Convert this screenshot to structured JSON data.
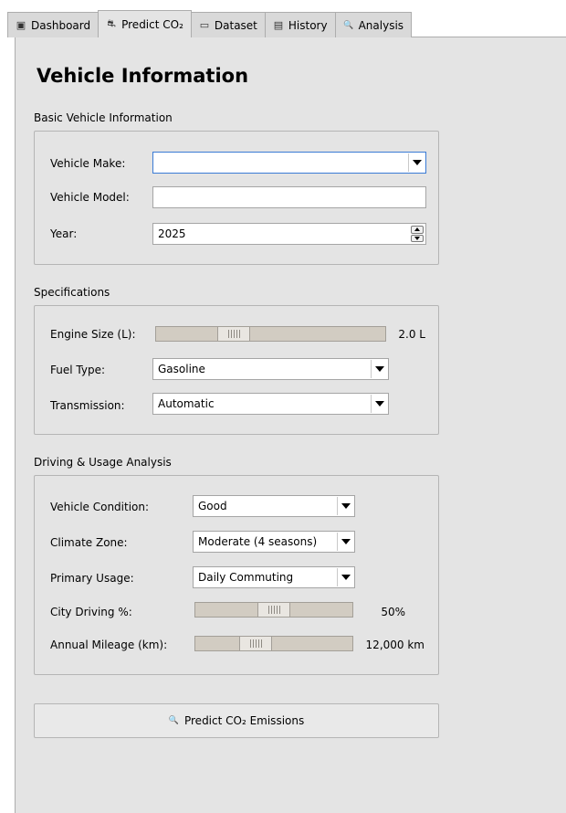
{
  "tabs": [
    {
      "label": "Dashboard",
      "icon": "dashboard-icon",
      "glyph": "▣"
    },
    {
      "label": "Predict CO₂",
      "icon": "car-icon",
      "glyph": "⛐",
      "active": true
    },
    {
      "label": "Dataset",
      "icon": "folder-icon",
      "glyph": "▭"
    },
    {
      "label": "History",
      "icon": "chart-icon",
      "glyph": "▤"
    },
    {
      "label": "Analysis",
      "icon": "magnifier-icon",
      "glyph": "🔍"
    }
  ],
  "page_title": "Vehicle Information",
  "basic": {
    "section_label": "Basic Vehicle Information",
    "make_label": "Vehicle Make:",
    "make_value": "",
    "model_label": "Vehicle Model:",
    "model_value": "",
    "year_label": "Year:",
    "year_value": "2025"
  },
  "specs": {
    "section_label": "Specifications",
    "engine_label": "Engine Size (L):",
    "engine_value_text": "2.0 L",
    "engine_slider_fraction": 0.31,
    "fuel_label": "Fuel Type:",
    "fuel_value": "Gasoline",
    "transmission_label": "Transmission:",
    "transmission_value": "Automatic"
  },
  "driving": {
    "section_label": "Driving & Usage Analysis",
    "condition_label": "Vehicle Condition:",
    "condition_value": "Good",
    "climate_label": "Climate Zone:",
    "climate_value": "Moderate (4 seasons)",
    "usage_label": "Primary Usage:",
    "usage_value": "Daily Commuting",
    "city_label": "City Driving %:",
    "city_value_text": "50%",
    "city_fraction": 0.5,
    "mileage_label": "Annual Mileage (km):",
    "mileage_value_text": "12,000 km",
    "mileage_fraction": 0.35
  },
  "predict_button": {
    "label": "Predict CO₂ Emissions",
    "icon": "magnifier-icon"
  },
  "colors": {
    "pane_bg": "#e4e4e4",
    "focus_border": "#3a7bd5",
    "slider_track": "#d2ccc2"
  }
}
